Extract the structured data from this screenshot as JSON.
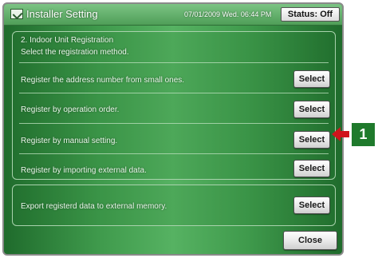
{
  "window": {
    "title": "Installer Setting",
    "datetime": "07/01/2009 Wed. 06:44 PM",
    "status": "Status: Off"
  },
  "section": {
    "heading": "2. Indoor Unit Registration",
    "instruction": "Select the registration method."
  },
  "options": [
    {
      "label": "Register the address number from small ones.",
      "button": "Select"
    },
    {
      "label": "Register by operation order.",
      "button": "Select"
    },
    {
      "label": "Register by manual setting.",
      "button": "Select"
    },
    {
      "label": "Register by importing external data.",
      "button": "Select"
    }
  ],
  "export": {
    "label": "Export registerd data to external memory.",
    "button": "Select"
  },
  "footer": {
    "close_label": "Close"
  },
  "callout": {
    "number": "1",
    "color": "#1f7a2c",
    "arrow_color": "#d0141c"
  }
}
